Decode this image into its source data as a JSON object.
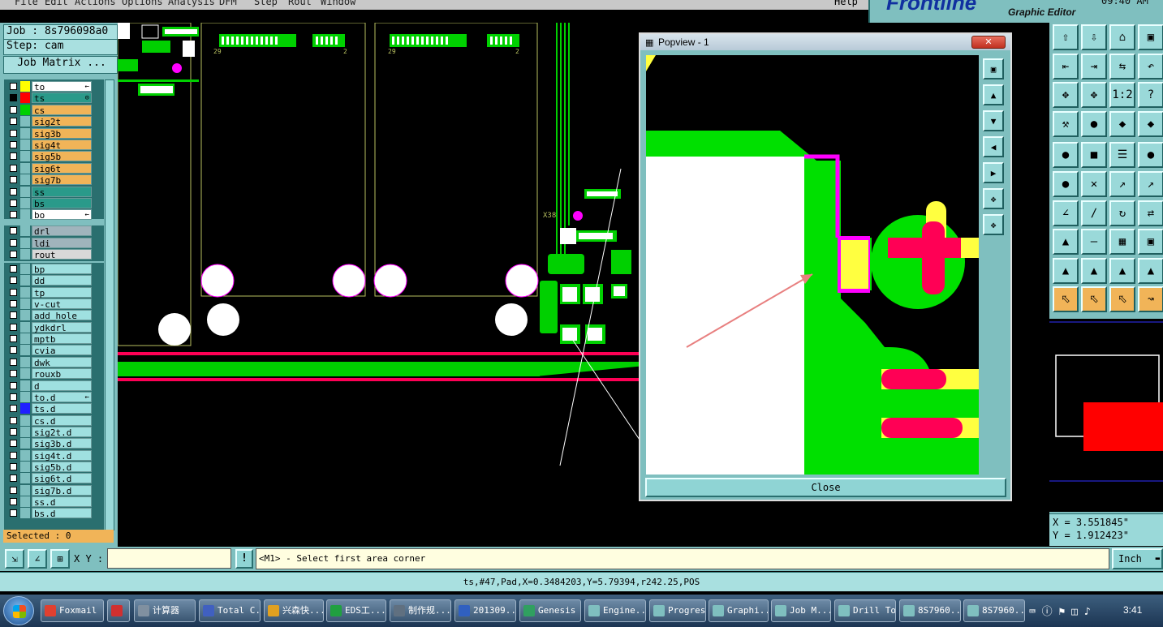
{
  "menu": [
    "File",
    "Edit",
    "Actions",
    "Options",
    "Analysis",
    "DFM",
    "Step",
    "Rout",
    "Window",
    "Help"
  ],
  "brand": {
    "logo": "Frontline",
    "subtitle": "Graphic Editor",
    "clock_partial": "09:40 AM"
  },
  "job": {
    "job_label": "Job : 8s796098a0",
    "step_label": "Step: cam",
    "matrix_button": "Job Matrix ..."
  },
  "layers_group1": [
    {
      "name": "to",
      "color": "#ffff00",
      "tag": "←",
      "bg": "#ffffff",
      "checked": false
    },
    {
      "name": "ts",
      "color": "#ff0000",
      "tag": "⊙",
      "bg": "#2a9a8a",
      "checked": true
    },
    {
      "name": "cs",
      "color": "#00d000",
      "tag": "",
      "bg": "#f1b458",
      "checked": false
    },
    {
      "name": "sig2t",
      "color": "",
      "tag": "",
      "bg": "#f1b458",
      "checked": false
    },
    {
      "name": "sig3b",
      "color": "",
      "tag": "",
      "bg": "#f1b458",
      "checked": false
    },
    {
      "name": "sig4t",
      "color": "",
      "tag": "",
      "bg": "#f1b458",
      "checked": false
    },
    {
      "name": "sig5b",
      "color": "",
      "tag": "",
      "bg": "#f1b458",
      "checked": false
    },
    {
      "name": "sig6t",
      "color": "",
      "tag": "",
      "bg": "#f1b458",
      "checked": false
    },
    {
      "name": "sig7b",
      "color": "",
      "tag": "",
      "bg": "#f1b458",
      "checked": false
    },
    {
      "name": "ss",
      "color": "",
      "tag": "",
      "bg": "#2a9a8a",
      "checked": false
    },
    {
      "name": "bs",
      "color": "",
      "tag": "",
      "bg": "#2a9a8a",
      "checked": false
    },
    {
      "name": "bo",
      "color": "",
      "tag": "←",
      "bg": "#ffffff",
      "checked": false
    }
  ],
  "layers_group2": [
    {
      "name": "drl",
      "bg": "#a0b4bc"
    },
    {
      "name": "ldi",
      "bg": "#a0b4bc"
    },
    {
      "name": "rout",
      "bg": "#d8d8d8"
    }
  ],
  "layers_group3": [
    {
      "name": "bp",
      "color": "",
      "tag": ""
    },
    {
      "name": "dd",
      "color": "",
      "tag": ""
    },
    {
      "name": "tp",
      "color": "",
      "tag": ""
    },
    {
      "name": "v-cut",
      "color": "",
      "tag": ""
    },
    {
      "name": "add_hole",
      "color": "",
      "tag": ""
    },
    {
      "name": "ydkdrl",
      "color": "",
      "tag": ""
    },
    {
      "name": "mptb",
      "color": "",
      "tag": ""
    },
    {
      "name": "cvia",
      "color": "",
      "tag": ""
    },
    {
      "name": "dwk",
      "color": "",
      "tag": ""
    },
    {
      "name": "rouxb",
      "color": "",
      "tag": ""
    },
    {
      "name": "d",
      "color": "",
      "tag": ""
    },
    {
      "name": "to.d",
      "color": "",
      "tag": "←"
    },
    {
      "name": "ts.d",
      "color": "#2020ff",
      "tag": ""
    },
    {
      "name": "cs.d",
      "color": "",
      "tag": ""
    },
    {
      "name": "sig2t.d",
      "color": "",
      "tag": ""
    },
    {
      "name": "sig3b.d",
      "color": "",
      "tag": ""
    },
    {
      "name": "sig4t.d",
      "color": "",
      "tag": ""
    },
    {
      "name": "sig5b.d",
      "color": "",
      "tag": ""
    },
    {
      "name": "sig6t.d",
      "color": "",
      "tag": ""
    },
    {
      "name": "sig7b.d",
      "color": "",
      "tag": ""
    },
    {
      "name": "ss.d",
      "color": "",
      "tag": ""
    },
    {
      "name": "bs.d",
      "color": "",
      "tag": ""
    }
  ],
  "selected": "Selected : 0",
  "coords": {
    "x": "X = 3.551845\"",
    "y": "Y = 1.912423\""
  },
  "popview": {
    "title": "Popview - 1",
    "close_label": "Close"
  },
  "canvas_labels": {
    "num29a": "29",
    "num2a": "2",
    "num29b": "29",
    "num2b": "2",
    "x38": "X38"
  },
  "bottom": {
    "xy_label": "X Y :",
    "xy_value": "",
    "prompt": "<M1> - Select first area corner",
    "units": "Inch",
    "status": "ts,#47,Pad,X=0.3484203,Y=5.79394,r242.25,POS"
  },
  "taskbar": {
    "items": [
      {
        "label": "Foxmail",
        "color": "#e04030"
      },
      {
        "label": "",
        "color": "#d03030"
      },
      {
        "label": "计算器",
        "color": "#8090a0"
      },
      {
        "label": "Total C...",
        "color": "#4060c0"
      },
      {
        "label": "兴森快...",
        "color": "#e0a020"
      },
      {
        "label": "EDS工...",
        "color": "#20a040"
      },
      {
        "label": "制作规...",
        "color": "#607080"
      },
      {
        "label": "201309...",
        "color": "#3060c0"
      },
      {
        "label": "Genesis",
        "color": "#30a060"
      },
      {
        "label": "Engine...",
        "color": "#7fbfbf"
      },
      {
        "label": "Progress",
        "color": "#7fbfbf"
      },
      {
        "label": "Graphi...",
        "color": "#7fbfbf"
      },
      {
        "label": "Job M...",
        "color": "#7fbfbf"
      },
      {
        "label": "Drill To...",
        "color": "#7fbfbf"
      },
      {
        "label": "8S7960...",
        "color": "#7fbfbf"
      },
      {
        "label": "8S7960...",
        "color": "#7fbfbf"
      }
    ],
    "time": "3:41"
  },
  "colors": {
    "accent": "#7fbfbf",
    "pad_green": "#00e000",
    "trace_magenta": "#ff00ff",
    "pad_yellow": "#ffff40",
    "pad_red": "#ff0055"
  }
}
